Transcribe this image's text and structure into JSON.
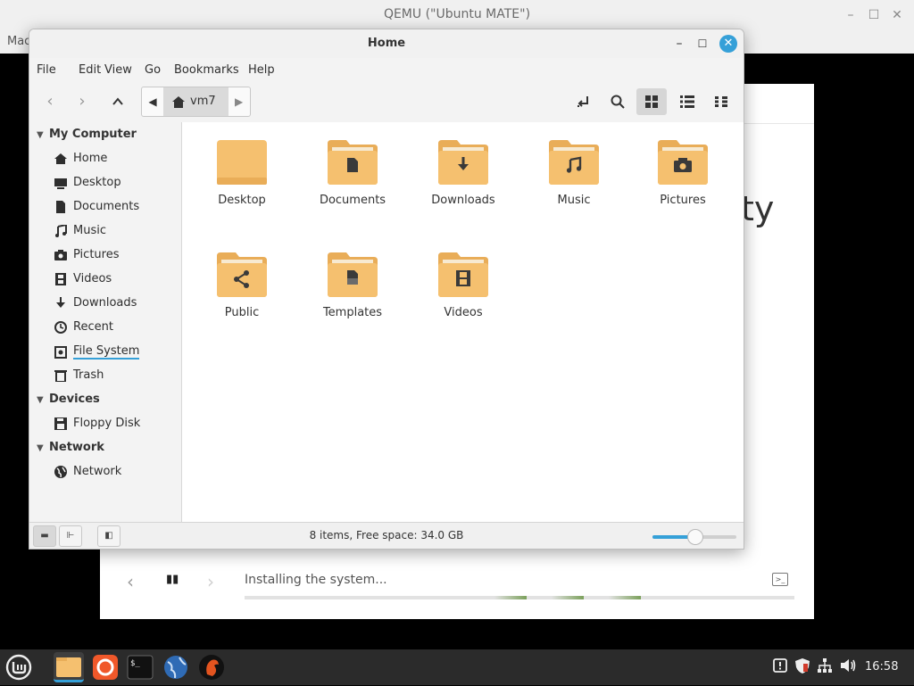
{
  "host": {
    "title": "QEMU (\"Ubuntu MATE\")",
    "menu_partial": "Mac"
  },
  "installer": {
    "big_text_partial": "ty",
    "status": "Installing the system..."
  },
  "window": {
    "title": "Home"
  },
  "menu": [
    "File",
    "Edit",
    "View",
    "Go",
    "Bookmarks",
    "Help"
  ],
  "path": {
    "current": "vm7"
  },
  "sidebar": {
    "sections": [
      {
        "title": "My Computer",
        "items": [
          {
            "label": "Home",
            "icon": "home-icon"
          },
          {
            "label": "Desktop",
            "icon": "desktop-icon"
          },
          {
            "label": "Documents",
            "icon": "documents-icon"
          },
          {
            "label": "Music",
            "icon": "music-icon"
          },
          {
            "label": "Pictures",
            "icon": "camera-icon"
          },
          {
            "label": "Videos",
            "icon": "film-icon"
          },
          {
            "label": "Downloads",
            "icon": "download-icon"
          },
          {
            "label": "Recent",
            "icon": "clock-icon"
          },
          {
            "label": "File System",
            "icon": "drive-icon"
          },
          {
            "label": "Trash",
            "icon": "trash-icon"
          }
        ]
      },
      {
        "title": "Devices",
        "items": [
          {
            "label": "Floppy Disk",
            "icon": "floppy-icon"
          }
        ]
      },
      {
        "title": "Network",
        "items": [
          {
            "label": "Network",
            "icon": "globe-icon"
          }
        ]
      }
    ]
  },
  "files": [
    {
      "name": "Desktop",
      "emblem": "none"
    },
    {
      "name": "Documents",
      "emblem": "document"
    },
    {
      "name": "Downloads",
      "emblem": "download"
    },
    {
      "name": "Music",
      "emblem": "music"
    },
    {
      "name": "Pictures",
      "emblem": "camera"
    },
    {
      "name": "Public",
      "emblem": "share"
    },
    {
      "name": "Templates",
      "emblem": "template"
    },
    {
      "name": "Videos",
      "emblem": "film"
    }
  ],
  "status": {
    "text": "8 items, Free space: 34.0 GB",
    "zoom_level": 0.5
  },
  "clock": "16:58",
  "colors": {
    "folder": "#f5c06f",
    "folder_tab": "#e9ad58",
    "accent": "#35a0d8"
  }
}
